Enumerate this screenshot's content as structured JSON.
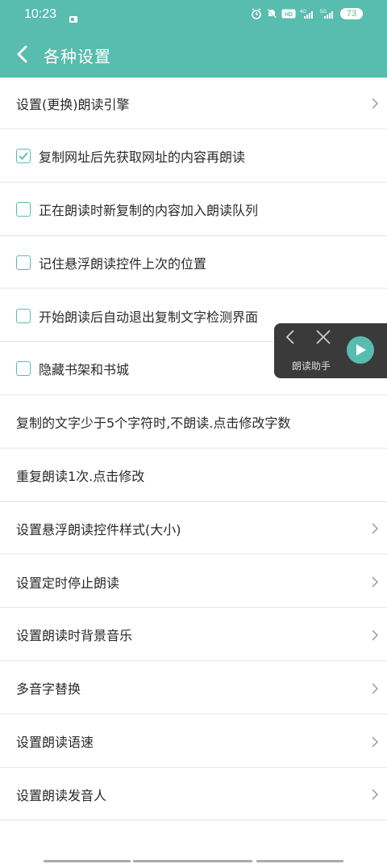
{
  "status_bar": {
    "time": "10:23",
    "battery": "73"
  },
  "app_bar": {
    "title": "各种设置"
  },
  "settings": [
    {
      "label": "设置(更换)朗读引擎",
      "type": "link"
    },
    {
      "label": "复制网址后先获取网址的内容再朗读",
      "type": "checkbox",
      "checked": true
    },
    {
      "label": "正在朗读时新复制的内容加入朗读队列",
      "type": "checkbox",
      "checked": false
    },
    {
      "label": "记住悬浮朗读控件上次的位置",
      "type": "checkbox",
      "checked": false
    },
    {
      "label": "开始朗读后自动退出复制文字检测界面",
      "type": "checkbox",
      "checked": false
    },
    {
      "label": "隐藏书架和书城",
      "type": "checkbox",
      "checked": false
    },
    {
      "label": "复制的文字少于5个字符时,不朗读.点击修改字数",
      "type": "text"
    },
    {
      "label": "重复朗读1次.点击修改",
      "type": "text"
    },
    {
      "label": "设置悬浮朗读控件样式(大小)",
      "type": "link"
    },
    {
      "label": "设置定时停止朗读",
      "type": "link"
    },
    {
      "label": "设置朗读时背景音乐",
      "type": "link"
    },
    {
      "label": "多音字替换",
      "type": "link"
    },
    {
      "label": "设置朗读语速",
      "type": "link"
    },
    {
      "label": "设置朗读发音人",
      "type": "link"
    }
  ],
  "floating_widget": {
    "label": "朗读助手"
  },
  "colors": {
    "accent": "#58bcae",
    "widget_bg": "#3a3a3a"
  }
}
